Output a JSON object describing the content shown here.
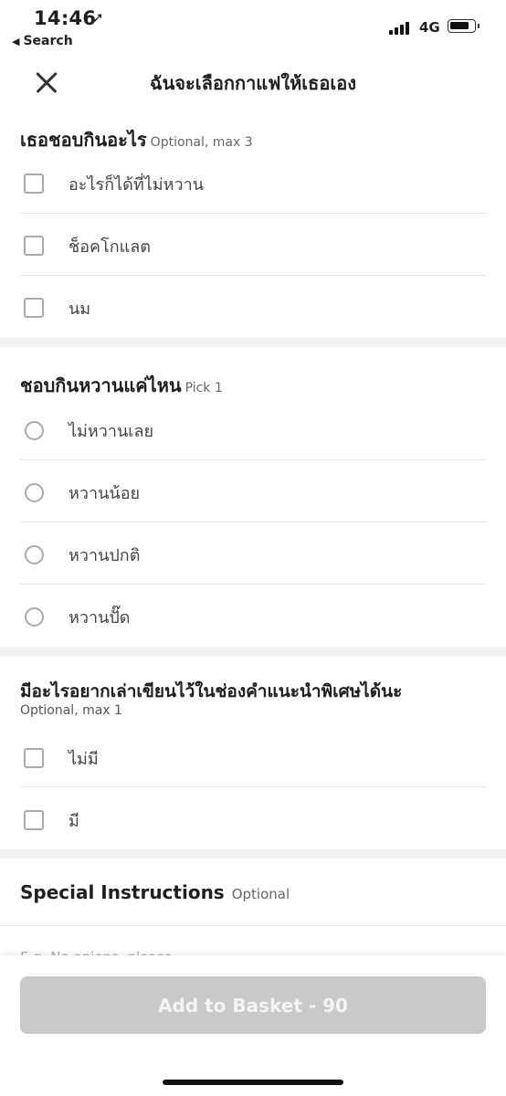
{
  "status_bar": {
    "time": "14:46",
    "location_glyph": "➚",
    "back_label": "Search",
    "network": "4G"
  },
  "header": {
    "title": "ฉันจะเลือกกาแฟให้เธอเอง"
  },
  "sections": [
    {
      "title": "เธอชอบกินอะไร",
      "subtitle": "Optional, max 3",
      "options": [
        "อะไรก็ได้ที่ไม่หวาน",
        "ช็อคโกแลต",
        "นม"
      ]
    },
    {
      "title": "ชอบกินหวานแค่ไหน",
      "subtitle": "Pick 1",
      "options": [
        "ไม่หวานเลย",
        "หวานน้อย",
        "หวานปกติ",
        "หวานปั๊ด"
      ]
    },
    {
      "title": "มีอะไรอยากเล่าเขียนไว้ในช่องคำแนะนำพิเศษได้นะ",
      "subtitle": "Optional, max 1",
      "options": [
        "ไม่มี",
        "มี"
      ]
    }
  ],
  "special_instructions": {
    "title": "Special Instructions",
    "subtitle": "Optional",
    "placeholder": "E.g. No onions, please"
  },
  "footer": {
    "add_button_label": "Add to Basket - 90"
  },
  "colors": {
    "button_disabled": "#c9c9c9",
    "separator": "#f1f1f1"
  }
}
